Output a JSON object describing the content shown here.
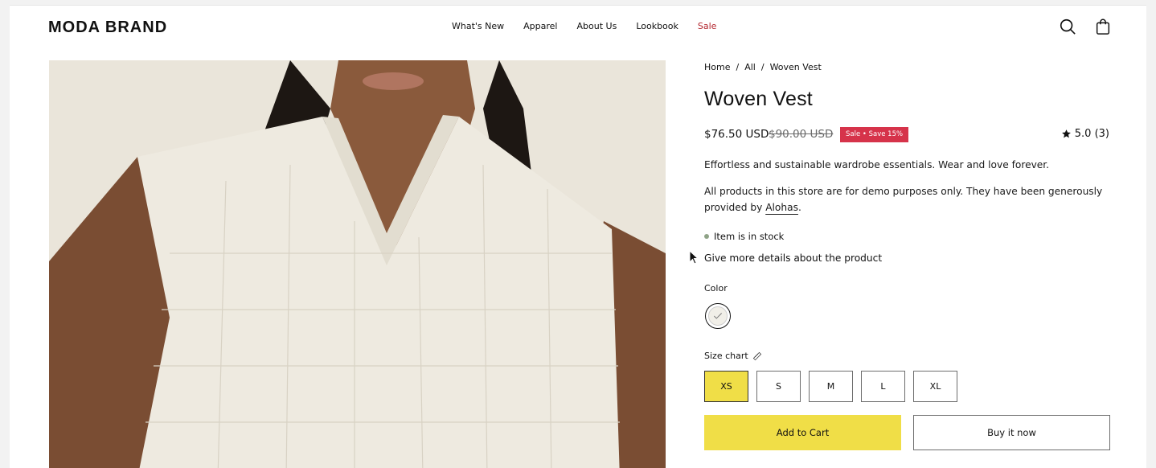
{
  "header": {
    "brand": "MODA BRAND",
    "nav": [
      {
        "label": "What's New"
      },
      {
        "label": "Apparel"
      },
      {
        "label": "About Us"
      },
      {
        "label": "Lookbook"
      },
      {
        "label": "Sale"
      }
    ],
    "icons": [
      "search-icon",
      "shopping-bag-icon"
    ]
  },
  "product": {
    "image_subject": "woman wearing cream woven knit vest",
    "breadcrumb": {
      "home": "Home",
      "sep1": "/",
      "all": "All",
      "sep2": "/",
      "current": "Woven Vest"
    },
    "title": "Woven Vest",
    "price": "$76.50 USD",
    "compare_price": "$90.00 USD",
    "badge": "Sale  •  Save 15%",
    "rating": "5.0 (3)",
    "description": "Effortless and sustainable wardrobe essentials. Wear and love forever.",
    "demo_note_prefix": "All products in this store are for demo purposes only. They have been generously provided by ",
    "demo_note_link": "Alohas",
    "demo_note_suffix": ".",
    "stock": "Item is in stock",
    "details_link": "Give more details about the product",
    "color_label": "Color",
    "size_chart_label": "Size chart",
    "sizes": [
      "XS",
      "S",
      "M",
      "L",
      "XL"
    ],
    "selected_size": "XS",
    "add_to_cart": "Add to Cart",
    "buy_now": "Buy it now"
  },
  "colors": {
    "accent_yellow": "#f0de47",
    "sale_red": "#d6334a",
    "sale_nav": "#b3262e",
    "stock_dot": "#8fa387"
  }
}
